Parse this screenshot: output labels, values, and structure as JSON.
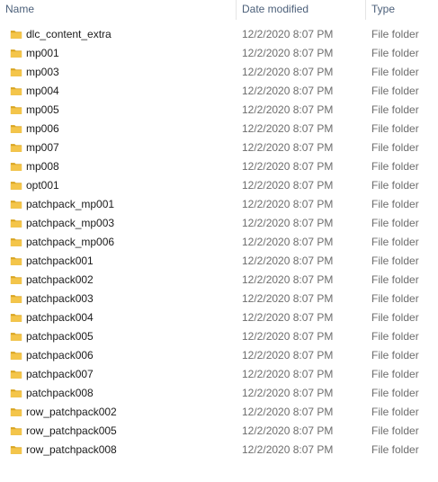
{
  "columns": {
    "name": "Name",
    "date": "Date modified",
    "type": "Type"
  },
  "folder_icon_color": "#f4c54a",
  "files": [
    {
      "name": "dlc_content_extra",
      "date": "12/2/2020 8:07 PM",
      "type": "File folder"
    },
    {
      "name": "mp001",
      "date": "12/2/2020 8:07 PM",
      "type": "File folder"
    },
    {
      "name": "mp003",
      "date": "12/2/2020 8:07 PM",
      "type": "File folder"
    },
    {
      "name": "mp004",
      "date": "12/2/2020 8:07 PM",
      "type": "File folder"
    },
    {
      "name": "mp005",
      "date": "12/2/2020 8:07 PM",
      "type": "File folder"
    },
    {
      "name": "mp006",
      "date": "12/2/2020 8:07 PM",
      "type": "File folder"
    },
    {
      "name": "mp007",
      "date": "12/2/2020 8:07 PM",
      "type": "File folder"
    },
    {
      "name": "mp008",
      "date": "12/2/2020 8:07 PM",
      "type": "File folder"
    },
    {
      "name": "opt001",
      "date": "12/2/2020 8:07 PM",
      "type": "File folder"
    },
    {
      "name": "patchpack_mp001",
      "date": "12/2/2020 8:07 PM",
      "type": "File folder"
    },
    {
      "name": "patchpack_mp003",
      "date": "12/2/2020 8:07 PM",
      "type": "File folder"
    },
    {
      "name": "patchpack_mp006",
      "date": "12/2/2020 8:07 PM",
      "type": "File folder"
    },
    {
      "name": "patchpack001",
      "date": "12/2/2020 8:07 PM",
      "type": "File folder"
    },
    {
      "name": "patchpack002",
      "date": "12/2/2020 8:07 PM",
      "type": "File folder"
    },
    {
      "name": "patchpack003",
      "date": "12/2/2020 8:07 PM",
      "type": "File folder"
    },
    {
      "name": "patchpack004",
      "date": "12/2/2020 8:07 PM",
      "type": "File folder"
    },
    {
      "name": "patchpack005",
      "date": "12/2/2020 8:07 PM",
      "type": "File folder"
    },
    {
      "name": "patchpack006",
      "date": "12/2/2020 8:07 PM",
      "type": "File folder"
    },
    {
      "name": "patchpack007",
      "date": "12/2/2020 8:07 PM",
      "type": "File folder"
    },
    {
      "name": "patchpack008",
      "date": "12/2/2020 8:07 PM",
      "type": "File folder"
    },
    {
      "name": "row_patchpack002",
      "date": "12/2/2020 8:07 PM",
      "type": "File folder"
    },
    {
      "name": "row_patchpack005",
      "date": "12/2/2020 8:07 PM",
      "type": "File folder"
    },
    {
      "name": "row_patchpack008",
      "date": "12/2/2020 8:07 PM",
      "type": "File folder"
    }
  ]
}
